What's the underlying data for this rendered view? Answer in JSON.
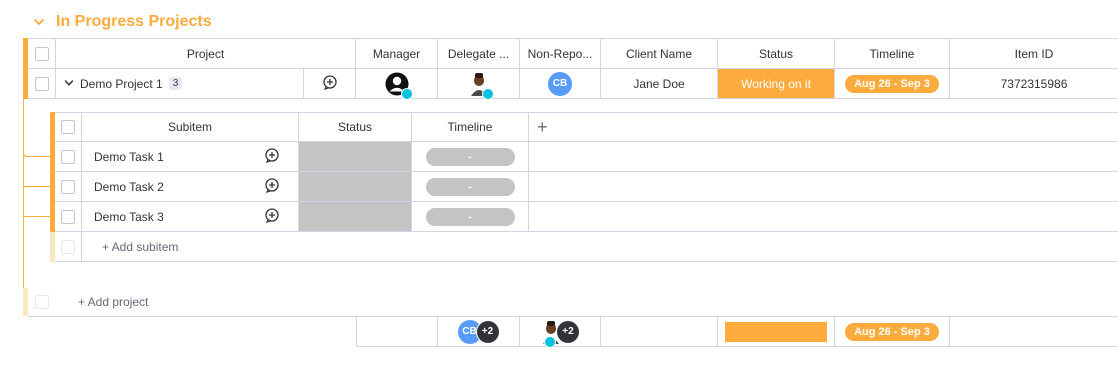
{
  "group": {
    "title": "In Progress Projects",
    "color": "#fdab3d"
  },
  "columns": {
    "project": "Project",
    "manager": "Manager",
    "delegate": "Delegate ...",
    "non_report": "Non-Repo...",
    "client_name": "Client Name",
    "status": "Status",
    "timeline": "Timeline",
    "item_id": "Item ID"
  },
  "item": {
    "name": "Demo Project 1",
    "subitem_count": "3",
    "non_report_initials": "CB",
    "client_name": "Jane Doe",
    "status": "Working on it",
    "status_color": "#fdab3d",
    "timeline": "Aug 26 - Sep 3",
    "item_id": "7372315986"
  },
  "subitems": {
    "columns": {
      "subitem": "Subitem",
      "status": "Status",
      "timeline": "Timeline"
    },
    "add_column_icon": "plus",
    "rows": [
      {
        "name": "Demo Task 1",
        "timeline": "-"
      },
      {
        "name": "Demo Task 2",
        "timeline": "-"
      },
      {
        "name": "Demo Task 3",
        "timeline": "-"
      }
    ],
    "add_label": "+ Add subitem"
  },
  "add_project_label": "+ Add project",
  "summary": {
    "delegate_initials": "CB",
    "delegate_more": "+2",
    "non_report_more": "+2",
    "timeline": "Aug 26 - Sep 3"
  }
}
